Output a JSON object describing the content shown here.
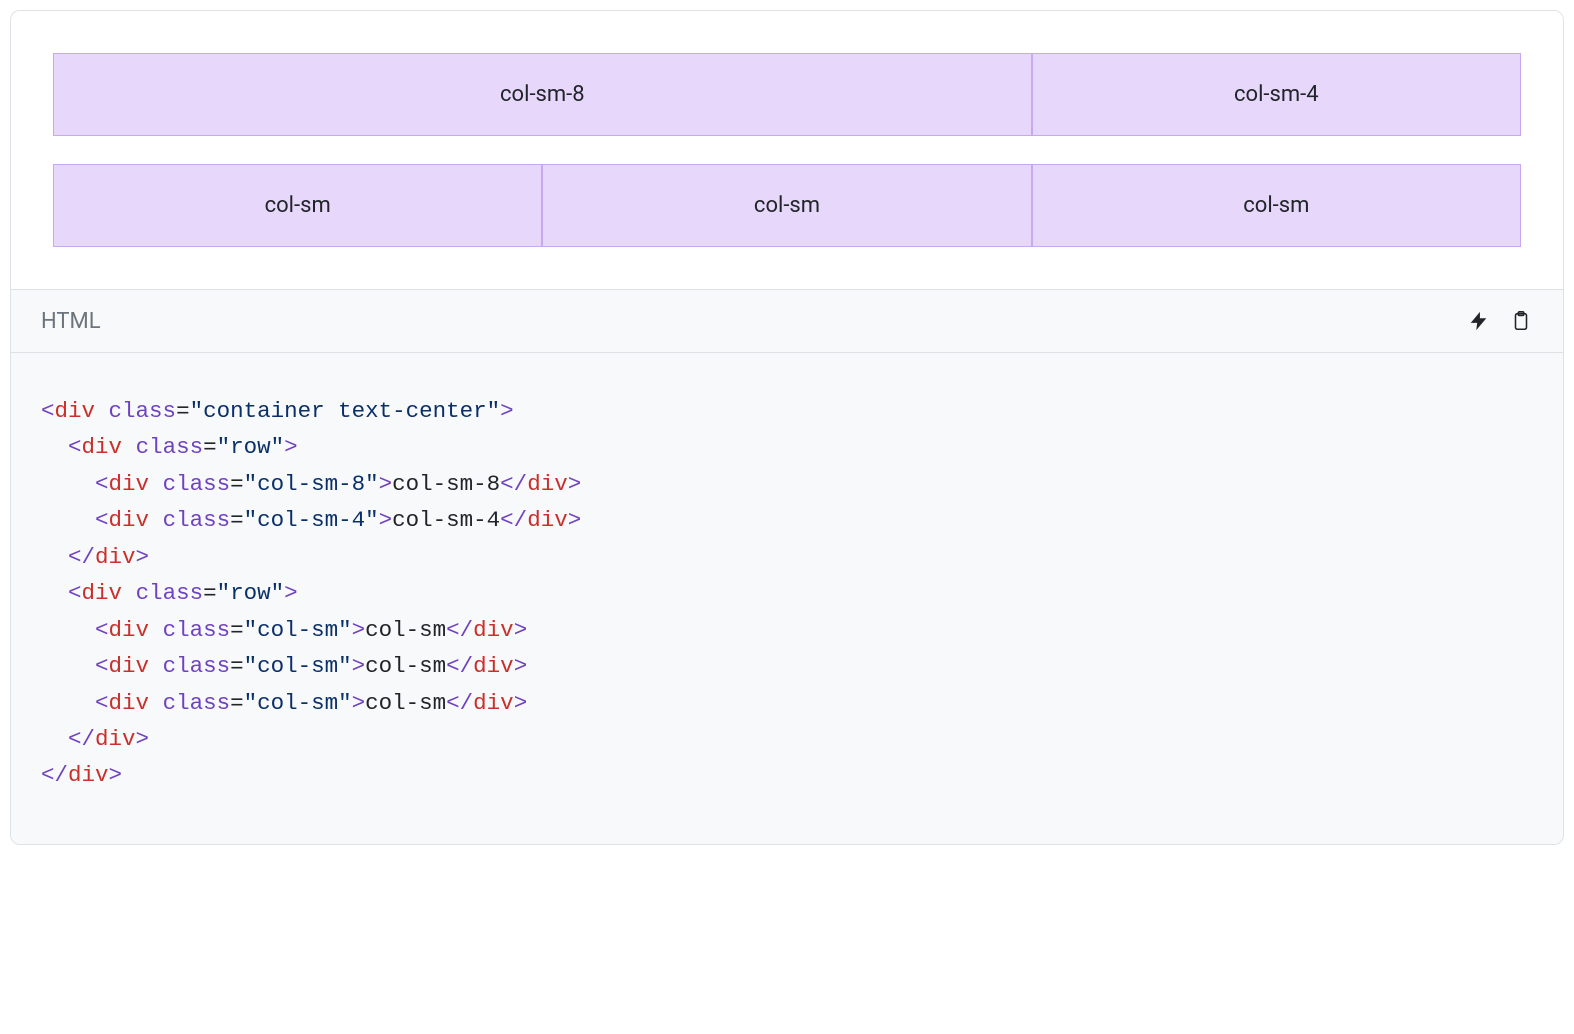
{
  "preview": {
    "row1": {
      "c1": "col-sm-8",
      "c2": "col-sm-4"
    },
    "row2": {
      "c1": "col-sm",
      "c2": "col-sm",
      "c3": "col-sm"
    }
  },
  "code": {
    "lang_label": "HTML",
    "tokens": {
      "lt": "<",
      "gt": ">",
      "lts": "</",
      "div": "div",
      "class": "class",
      "eq": "=",
      "q_container": "\"container text-center\"",
      "q_row": "\"row\"",
      "q_col8": "\"col-sm-8\"",
      "q_col4": "\"col-sm-4\"",
      "q_col": "\"col-sm\"",
      "txt_col8": "col-sm-8",
      "txt_col4": "col-sm-4",
      "txt_col": "col-sm"
    },
    "indent": {
      "i1": "  ",
      "i2": "    "
    }
  }
}
